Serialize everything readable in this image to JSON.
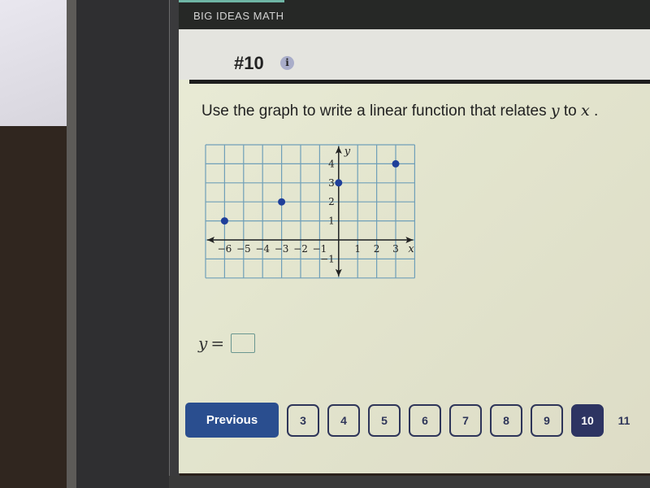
{
  "app": {
    "brand": "BIG IDEAS MATH"
  },
  "question": {
    "number": "#10",
    "info_icon": "i",
    "prompt_parts": [
      "Use the graph to write a linear function that relates ",
      "y",
      " to ",
      "x",
      " ."
    ]
  },
  "chart_data": {
    "type": "scatter",
    "title": "",
    "xlabel": "x",
    "ylabel": "y",
    "xlim": [
      -7,
      4
    ],
    "ylim": [
      -2,
      5
    ],
    "grid": true,
    "x_ticks": [
      -6,
      -5,
      -4,
      -3,
      -2,
      -1,
      1,
      2,
      3
    ],
    "y_ticks": [
      -1,
      1,
      2,
      3,
      4
    ],
    "x_tick_labels": [
      "−6",
      "−5",
      "−4",
      "−3",
      "−2",
      "−1",
      "1",
      "2",
      "3"
    ],
    "y_tick_labels": [
      "−1",
      "1",
      "2",
      "3",
      "4"
    ],
    "points": [
      {
        "x": -6,
        "y": 1
      },
      {
        "x": -3,
        "y": 2
      },
      {
        "x": 0,
        "y": 3
      },
      {
        "x": 3,
        "y": 4
      }
    ],
    "point_color": "#1f3f9a"
  },
  "answer": {
    "label": "y",
    "equals": "=",
    "value": ""
  },
  "pagination": {
    "previous_label": "Previous",
    "pages": [
      "3",
      "4",
      "5",
      "6",
      "7",
      "8",
      "9",
      "10",
      "11"
    ],
    "current": "10"
  }
}
